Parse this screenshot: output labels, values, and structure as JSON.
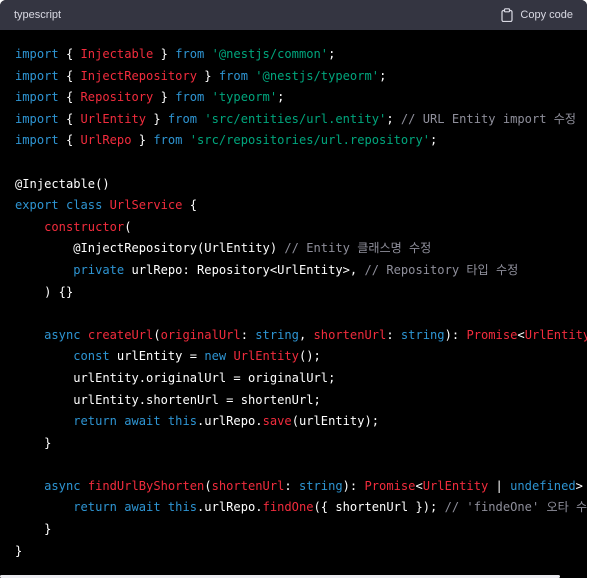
{
  "header": {
    "language": "typescript",
    "copy_label": "Copy code"
  },
  "code_lines": [
    [
      [
        "kw",
        "import"
      ],
      [
        "pl",
        " { "
      ],
      [
        "id",
        "Injectable"
      ],
      [
        "pl",
        " } "
      ],
      [
        "kw",
        "from"
      ],
      [
        "pl",
        " "
      ],
      [
        "str",
        "'@nestjs/common'"
      ],
      [
        "pl",
        ";"
      ]
    ],
    [
      [
        "kw",
        "import"
      ],
      [
        "pl",
        " { "
      ],
      [
        "id",
        "InjectRepository"
      ],
      [
        "pl",
        " } "
      ],
      [
        "kw",
        "from"
      ],
      [
        "pl",
        " "
      ],
      [
        "str",
        "'@nestjs/typeorm'"
      ],
      [
        "pl",
        ";"
      ]
    ],
    [
      [
        "kw",
        "import"
      ],
      [
        "pl",
        " { "
      ],
      [
        "id",
        "Repository"
      ],
      [
        "pl",
        " } "
      ],
      [
        "kw",
        "from"
      ],
      [
        "pl",
        " "
      ],
      [
        "str",
        "'typeorm'"
      ],
      [
        "pl",
        ";"
      ]
    ],
    [
      [
        "kw",
        "import"
      ],
      [
        "pl",
        " { "
      ],
      [
        "id",
        "UrlEntity"
      ],
      [
        "pl",
        " } "
      ],
      [
        "kw",
        "from"
      ],
      [
        "pl",
        " "
      ],
      [
        "str",
        "'src/entities/url.entity'"
      ],
      [
        "pl",
        "; "
      ],
      [
        "cm",
        "// URL Entity import 수정"
      ]
    ],
    [
      [
        "kw",
        "import"
      ],
      [
        "pl",
        " { "
      ],
      [
        "id",
        "UrlRepo"
      ],
      [
        "pl",
        " } "
      ],
      [
        "kw",
        "from"
      ],
      [
        "pl",
        " "
      ],
      [
        "str",
        "'src/repositories/url.repository'"
      ],
      [
        "pl",
        ";"
      ]
    ],
    [],
    [
      [
        "dc",
        "@Injectable()"
      ]
    ],
    [
      [
        "kw",
        "export"
      ],
      [
        "pl",
        " "
      ],
      [
        "kw",
        "class"
      ],
      [
        "pl",
        " "
      ],
      [
        "id",
        "UrlService"
      ],
      [
        "pl",
        " {"
      ]
    ],
    [
      [
        "pl",
        "    "
      ],
      [
        "id",
        "constructor"
      ],
      [
        "pl",
        "("
      ]
    ],
    [
      [
        "pl",
        "        "
      ],
      [
        "dc",
        "@InjectRepository"
      ],
      [
        "pl",
        "(UrlEntity) "
      ],
      [
        "cm",
        "// Entity 클래스명 수정"
      ]
    ],
    [
      [
        "pl",
        "        "
      ],
      [
        "kw",
        "private"
      ],
      [
        "pl",
        " urlRepo: Repository<UrlEntity>, "
      ],
      [
        "cm",
        "// Repository 타입 수정"
      ]
    ],
    [
      [
        "pl",
        "    ) {}"
      ]
    ],
    [],
    [
      [
        "pl",
        "    "
      ],
      [
        "kw",
        "async"
      ],
      [
        "pl",
        " "
      ],
      [
        "id",
        "createUrl"
      ],
      [
        "pl",
        "("
      ],
      [
        "id",
        "originalUrl"
      ],
      [
        "pl",
        ": "
      ],
      [
        "kw",
        "string"
      ],
      [
        "pl",
        ", "
      ],
      [
        "id",
        "shortenUrl"
      ],
      [
        "pl",
        ": "
      ],
      [
        "kw",
        "string"
      ],
      [
        "pl",
        "): "
      ],
      [
        "id",
        "Promise"
      ],
      [
        "pl",
        "<"
      ],
      [
        "id",
        "UrlEntity"
      ],
      [
        "pl",
        "> {"
      ]
    ],
    [
      [
        "pl",
        "        "
      ],
      [
        "kw",
        "const"
      ],
      [
        "pl",
        " urlEntity = "
      ],
      [
        "kw",
        "new"
      ],
      [
        "pl",
        " "
      ],
      [
        "id",
        "UrlEntity"
      ],
      [
        "pl",
        "();"
      ]
    ],
    [
      [
        "pl",
        "        urlEntity.originalUrl = originalUrl;"
      ]
    ],
    [
      [
        "pl",
        "        urlEntity.shortenUrl = shortenUrl;"
      ]
    ],
    [
      [
        "pl",
        "        "
      ],
      [
        "kw",
        "return"
      ],
      [
        "pl",
        " "
      ],
      [
        "kw",
        "await"
      ],
      [
        "pl",
        " "
      ],
      [
        "kw",
        "this"
      ],
      [
        "pl",
        ".urlRepo."
      ],
      [
        "id",
        "save"
      ],
      [
        "pl",
        "(urlEntity);"
      ]
    ],
    [
      [
        "pl",
        "    }"
      ]
    ],
    [],
    [
      [
        "pl",
        "    "
      ],
      [
        "kw",
        "async"
      ],
      [
        "pl",
        " "
      ],
      [
        "id",
        "findUrlByShorten"
      ],
      [
        "pl",
        "("
      ],
      [
        "id",
        "shortenUrl"
      ],
      [
        "pl",
        ": "
      ],
      [
        "kw",
        "string"
      ],
      [
        "pl",
        "): "
      ],
      [
        "id",
        "Promise"
      ],
      [
        "pl",
        "<"
      ],
      [
        "id",
        "UrlEntity"
      ],
      [
        "pl",
        " | "
      ],
      [
        "kw",
        "undefined"
      ],
      [
        "pl",
        "> {"
      ]
    ],
    [
      [
        "pl",
        "        "
      ],
      [
        "kw",
        "return"
      ],
      [
        "pl",
        " "
      ],
      [
        "kw",
        "await"
      ],
      [
        "pl",
        " "
      ],
      [
        "kw",
        "this"
      ],
      [
        "pl",
        ".urlRepo."
      ],
      [
        "id",
        "findOne"
      ],
      [
        "pl",
        "({ shortenUrl }); "
      ],
      [
        "cm",
        "// 'findeOne' 오타 수정"
      ]
    ],
    [
      [
        "pl",
        "    }"
      ]
    ],
    [
      [
        "pl",
        "}"
      ]
    ]
  ],
  "colors": {
    "keyword": "#2e95d3",
    "identifier": "#f22c3d",
    "string": "#00a67d",
    "comment": "#8f8f9b",
    "header_bg": "#343541",
    "code_bg": "#000000"
  }
}
